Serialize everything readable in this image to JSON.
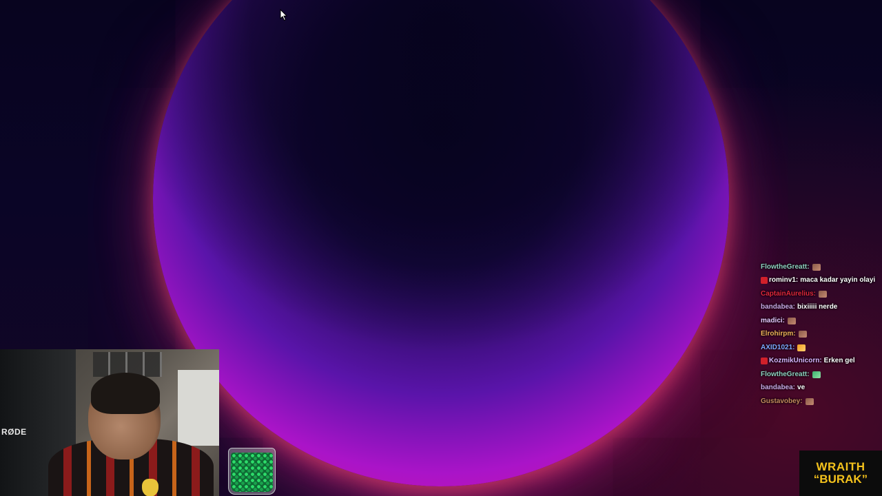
{
  "chat": {
    "lines": [
      {
        "user": "FlowtheGreatt:",
        "user_color": "#8fd0c0",
        "message": "",
        "badge": false,
        "emote": "emote"
      },
      {
        "user": "rominv1:",
        "user_color": "#ffffff",
        "message": "maca kadar yayin olayi",
        "badge": true,
        "emote": ""
      },
      {
        "user": "CaptainAurelius:",
        "user_color": "#e0263c",
        "message": "",
        "badge": false,
        "emote": "emote"
      },
      {
        "user": "bandabea:",
        "user_color": "#c9a9e6",
        "message": "bixiiiii nerde",
        "badge": false,
        "emote": ""
      },
      {
        "user": "madici:",
        "user_color": "#e5c8ff",
        "message": "",
        "badge": false,
        "emote": "emote"
      },
      {
        "user": "Elrohirpm:",
        "user_color": "#f0b35a",
        "message": "",
        "badge": false,
        "emote": "emote"
      },
      {
        "user": "AXID1021:",
        "user_color": "#7ea8ff",
        "message": "",
        "badge": false,
        "emote": "orange"
      },
      {
        "user": "KozmikUnicorn:",
        "user_color": "#d8b4ff",
        "message": "Erken gel",
        "badge": true,
        "emote": ""
      },
      {
        "user": "FlowtheGreatt:",
        "user_color": "#8fd0c0",
        "message": "",
        "badge": false,
        "emote": "green"
      },
      {
        "user": "bandabea:",
        "user_color": "#c9a9e6",
        "message": "ve",
        "badge": false,
        "emote": ""
      },
      {
        "user": "Gustavobey:",
        "user_color": "#c48a5e",
        "message": "",
        "badge": false,
        "emote": "emote"
      }
    ]
  },
  "webcam": {
    "mic_brand": "RØDE"
  },
  "logo": {
    "line1": "WRAITH",
    "line2": "“BURAK”"
  },
  "colors": {
    "logo_text": "#f4c21c",
    "logo_accent": "#d8102a",
    "orb_rim": "#ff4670"
  },
  "icons": {
    "cursor": "mouse-pointer-icon",
    "badge": "subscriber-badge-icon",
    "jar": "jellybean-jar-icon"
  }
}
